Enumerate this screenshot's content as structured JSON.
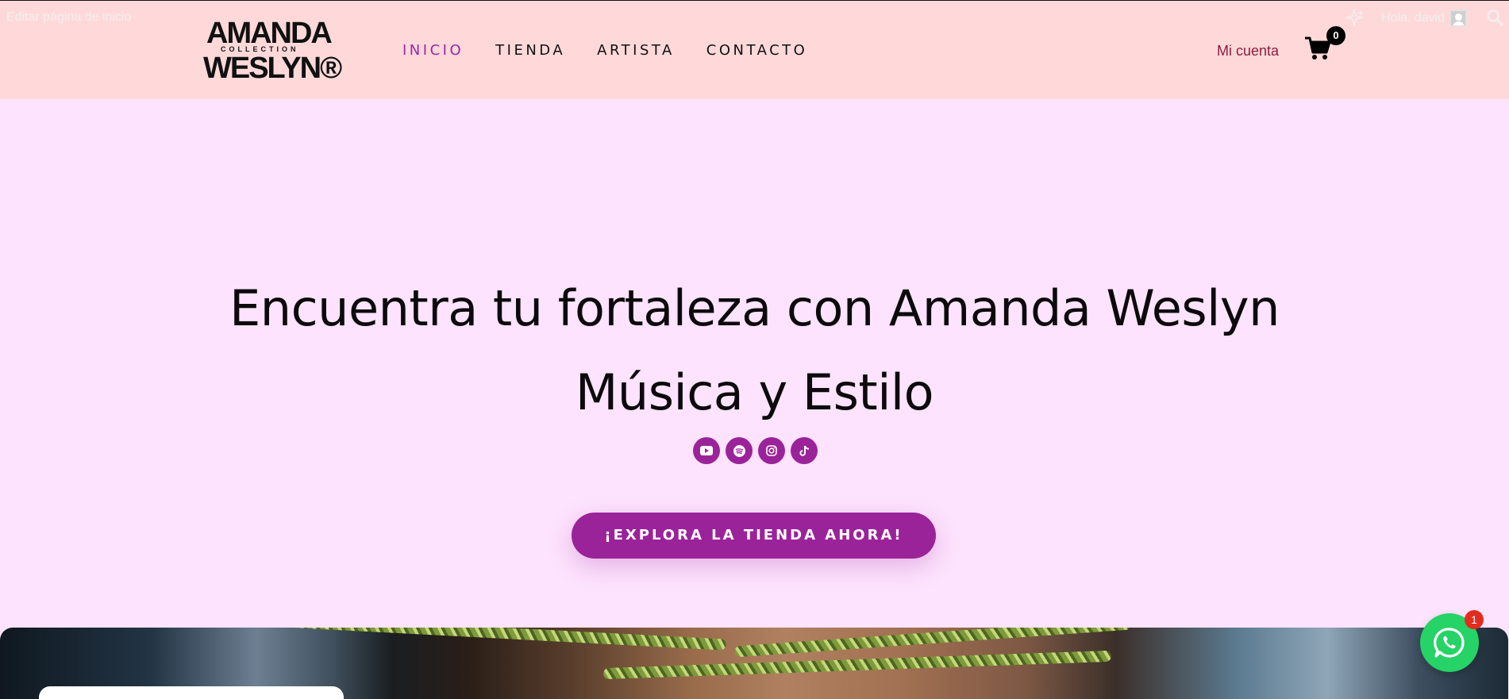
{
  "admin_bar": {
    "edit_label": "Editar página de inicio",
    "greeting": "Hola, david"
  },
  "logo": {
    "line1": "AMANDA",
    "line2": "COLLECTION",
    "line3": "WESLYN®"
  },
  "nav": {
    "items": [
      {
        "label": "INICIO",
        "active": true
      },
      {
        "label": "TIENDA",
        "active": false
      },
      {
        "label": "ARTISTA",
        "active": false
      },
      {
        "label": "CONTACTO",
        "active": false
      }
    ]
  },
  "header": {
    "account_label": "Mi cuenta",
    "cart_count": "0"
  },
  "hero": {
    "title_line1": "Encuentra tu fortaleza con Amanda Weslyn",
    "title_line2": "Música y Estilo",
    "cta_label": "¡EXPLORA LA TIENDA AHORA!",
    "socials": [
      "youtube-icon",
      "spotify-icon",
      "instagram-icon",
      "tiktok-icon"
    ]
  },
  "whatsapp": {
    "badge_count": "1"
  },
  "colors": {
    "header_bg": "#ffd9d9",
    "page_bg": "#fde3fd",
    "accent": "#9b239a",
    "account_text": "#8b1d3d",
    "whatsapp": "#25d366"
  }
}
